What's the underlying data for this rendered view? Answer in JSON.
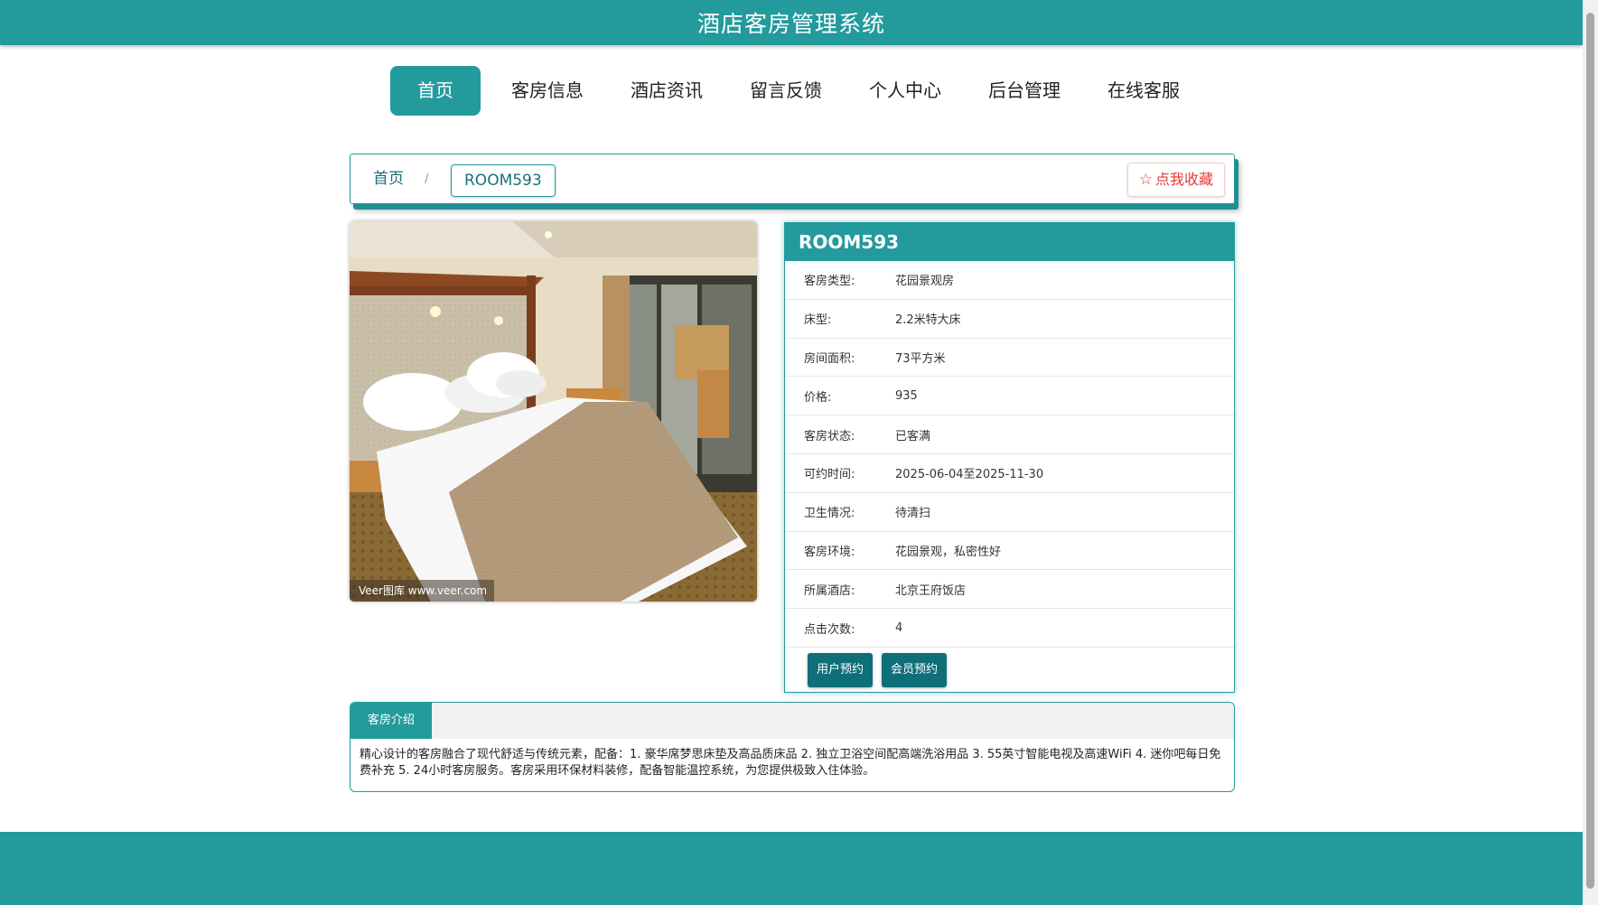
{
  "header": {
    "title": "酒店客房管理系统"
  },
  "nav": {
    "items": [
      "首页",
      "客房信息",
      "酒店资讯",
      "留言反馈",
      "个人中心",
      "后台管理",
      "在线客服"
    ],
    "active_index": 0
  },
  "breadcrumb": {
    "home": "首页",
    "separator": "/",
    "current": "ROOM593",
    "favorite_label": "点我收藏",
    "favorite_icon": "star-outline-icon"
  },
  "photo": {
    "watermark": "Veer图库 www.veer.com"
  },
  "room": {
    "title": "ROOM593",
    "fields": [
      {
        "label": "客房类型:",
        "value": "花园景观房"
      },
      {
        "label": "床型:",
        "value": "2.2米特大床"
      },
      {
        "label": "房间面积:",
        "value": "73平方米"
      },
      {
        "label": "价格:",
        "value": "935"
      },
      {
        "label": "客房状态:",
        "value": "已客满"
      },
      {
        "label": "可约时间:",
        "value": "2025-06-04至2025-11-30"
      },
      {
        "label": "卫生情况:",
        "value": "待清扫"
      },
      {
        "label": "客房环境:",
        "value": "花园景观，私密性好"
      },
      {
        "label": "所属酒店:",
        "value": "北京王府饭店"
      },
      {
        "label": "点击次数:",
        "value": "4"
      }
    ],
    "actions": {
      "user_booking": "用户预约",
      "member_booking": "会员预约"
    }
  },
  "intro": {
    "tab": "客房介绍",
    "text": "精心设计的客房融合了现代舒适与传统元素，配备：1. 豪华席梦思床垫及高品质床品 2. 独立卫浴空间配高端洗浴用品 3. 55英寸智能电视及高速WiFi 4. 迷你吧每日免费补充 5. 24小时客房服务。客房采用环保材料装修，配备智能温控系统，为您提供极致入住体验。"
  },
  "colors": {
    "primary": "#239a9c",
    "dark_button": "#0f6f79",
    "favorite": "#e4393c"
  }
}
